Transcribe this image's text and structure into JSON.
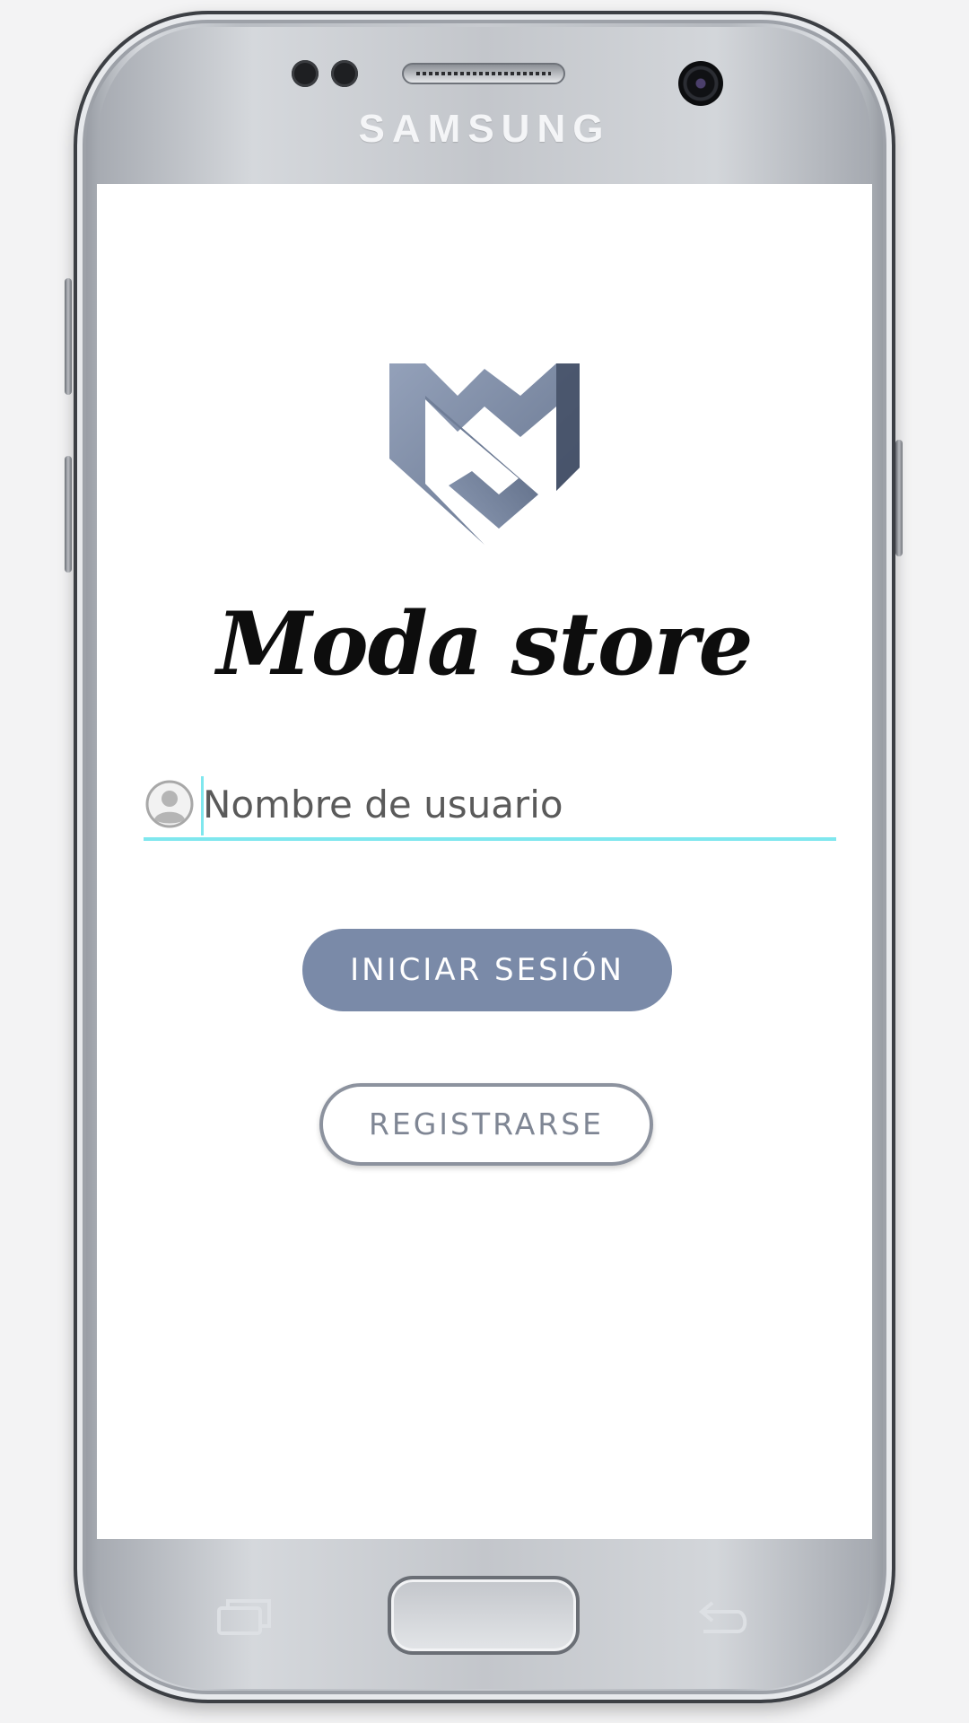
{
  "device": {
    "brand": "SAMSUNG"
  },
  "app": {
    "title": "Moda store",
    "logo_icon": "ms-monogram-logo"
  },
  "login_form": {
    "username_placeholder": "Nombre de usuario",
    "username_value": "",
    "username_icon": "user-avatar-icon",
    "login_button": "INICIAR SESIÓN",
    "register_button": "REGISTRARSE"
  },
  "colors": {
    "primary_button": "#7a8aa8",
    "input_underline": "#7fe7ee",
    "logo": "#7585a0",
    "title_text": "#0d0d0d"
  },
  "nav_keys": {
    "recents_icon": "recents-icon",
    "home_icon": "home-key",
    "back_icon": "back-icon"
  }
}
